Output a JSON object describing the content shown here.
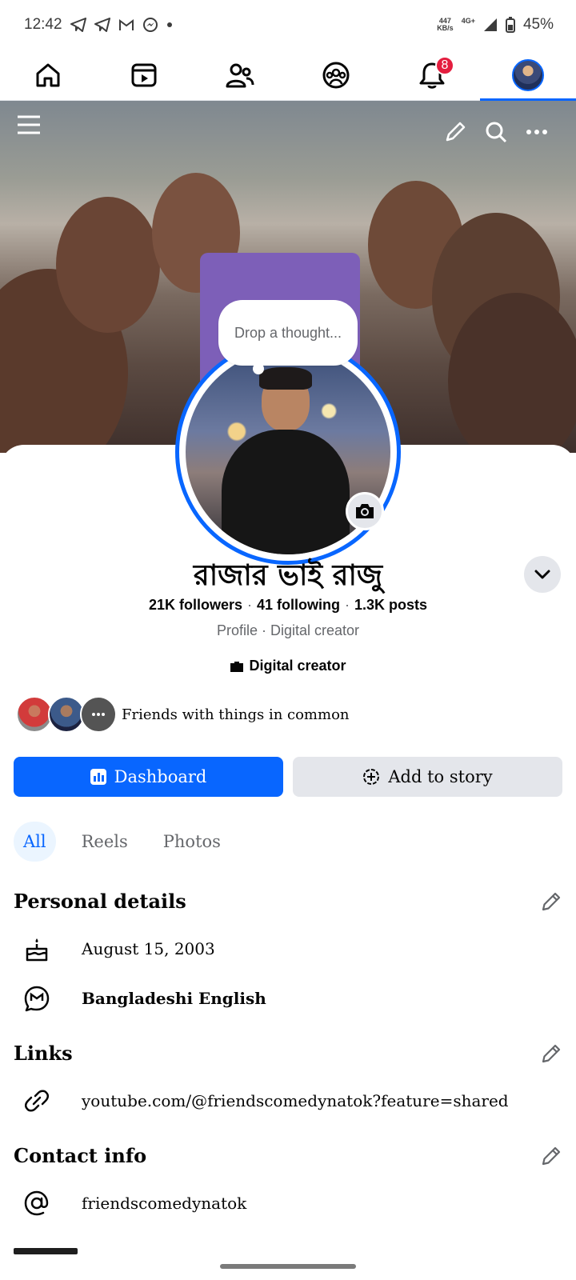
{
  "status_bar": {
    "time": "12:42",
    "speed_value": "447",
    "speed_unit": "KB/s",
    "network": "4G+",
    "battery": "45%"
  },
  "nav": {
    "notifications_badge": "8"
  },
  "profile": {
    "thought_placeholder": "Drop a thought...",
    "name": "রাজার ভাই রাজু",
    "followers": "21K followers",
    "following": "41 following",
    "posts": "1.3K posts",
    "dot": "·",
    "subtitle": "Profile · Digital creator",
    "category": "Digital creator",
    "friends_text": "Friends with things in common"
  },
  "actions": {
    "dashboard_label": "Dashboard",
    "add_story_label": "Add to story"
  },
  "tabs": [
    {
      "label": "All"
    },
    {
      "label": "Reels"
    },
    {
      "label": "Photos"
    }
  ],
  "personal_details": {
    "title": "Personal details",
    "birthday": "August 15, 2003",
    "language": "Bangladeshi English"
  },
  "links": {
    "title": "Links",
    "url": "youtube.com/@friendscomedynatok?feature=shared"
  },
  "contact": {
    "title": "Contact info",
    "username": "friendscomedynatok"
  },
  "colors": {
    "accent": "#0866ff",
    "badge": "#e41e3f",
    "secondary_button": "#e4e6eb",
    "muted_text": "#65676b"
  }
}
